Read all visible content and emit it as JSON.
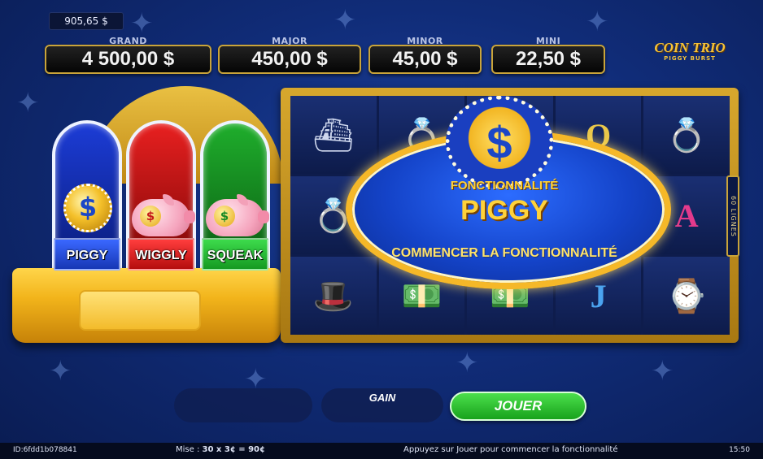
{
  "balance": "905,65 $",
  "jackpots": [
    {
      "label": "GRAND",
      "value": "4 500,00 $"
    },
    {
      "label": "MAJOR",
      "value": "450,00 $"
    },
    {
      "label": "MINOR",
      "value": "45,00 $"
    },
    {
      "label": "MINI",
      "value": "22,50 $"
    }
  ],
  "logo": {
    "title": "COIN TRIO",
    "subtitle": "PIGGY BURST"
  },
  "pedestal": {
    "labels": [
      "PIGGY",
      "WIGGLY",
      "SQUEAK"
    ],
    "colors": [
      "#1737b5",
      "#b50d0d",
      "#159a22"
    ]
  },
  "reels": {
    "lines_label": "60 LIGNES",
    "symbols": [
      [
        "yacht-icon",
        "ring-icon",
        "top-hat-icon"
      ],
      [
        "ring-icon",
        "money-icon",
        "money-icon"
      ],
      [
        "crown-icon",
        "coin-icon",
        "money-icon"
      ],
      [
        "letter-q",
        "letter-j",
        "letter-j"
      ],
      [
        "ring-icon",
        "letter-a",
        "watch-icon"
      ]
    ]
  },
  "feature": {
    "subtitle": "FONCTIONNALITÉ",
    "title": "PIGGY",
    "start_label": "COMMENCER LA FONCTIONNALITÉ"
  },
  "controls": {
    "gain_label": "GAIN",
    "play_label": "JOUER"
  },
  "footer": {
    "id": "ID:6fdd1b078841",
    "bet_prefix": "Mise : ",
    "bet_value": "30 x 3¢ = 90¢",
    "hint": "Appuyez sur Jouer pour commencer la fonctionnalité",
    "time": "15:50"
  },
  "colors": {
    "accent_gold": "#f5b828",
    "play_green": "#18a21c",
    "background": "#102c78"
  }
}
